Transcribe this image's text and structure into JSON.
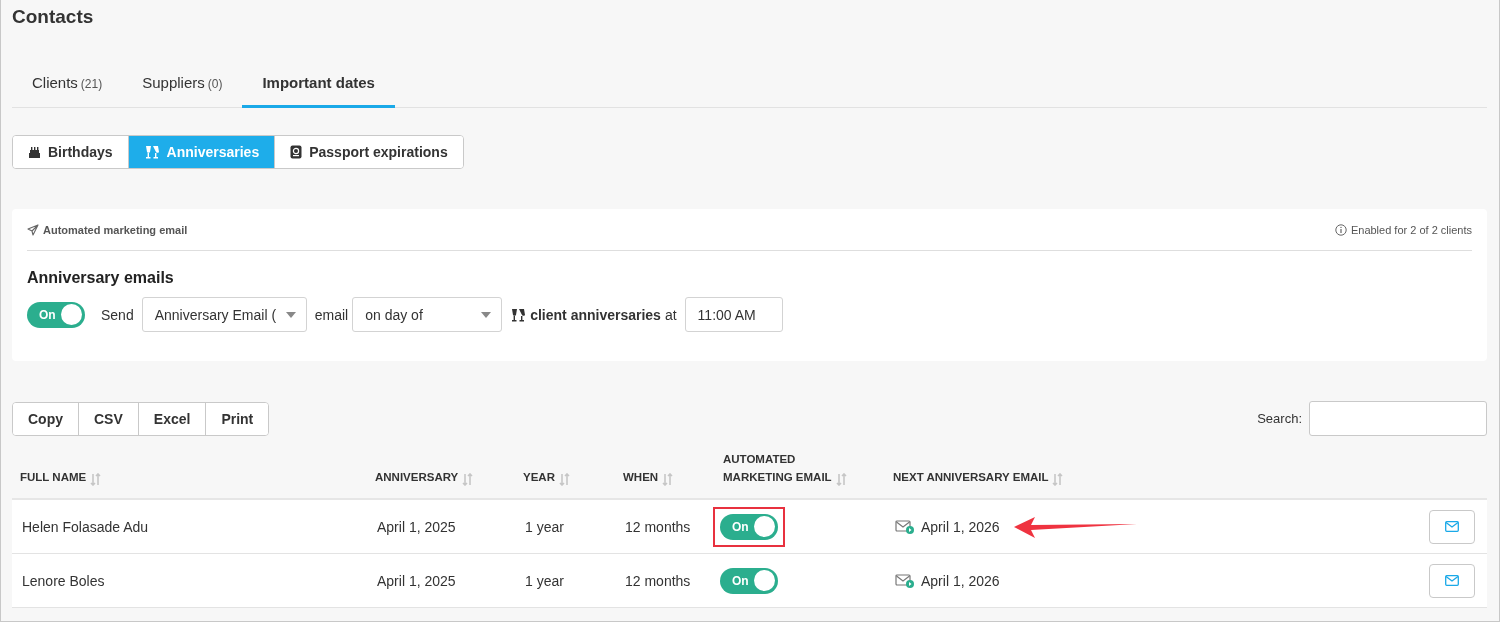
{
  "page": {
    "title": "Contacts"
  },
  "tabs": [
    {
      "label": "Clients",
      "count": "(21)",
      "selected": false
    },
    {
      "label": "Suppliers",
      "count": "(0)",
      "selected": false
    },
    {
      "label": "Important dates",
      "selected": true
    }
  ],
  "date_types": [
    {
      "label": "Birthdays",
      "kind": "cake",
      "selected": false
    },
    {
      "label": "Anniversaries",
      "kind": "cheers",
      "selected": true
    },
    {
      "label": "Passport expirations",
      "kind": "passport",
      "selected": false
    }
  ],
  "automation": {
    "caption": "Automated marketing email",
    "status": "Enabled for 2 of 2 clients",
    "heading": "Anniversary emails",
    "toggle": {
      "label": "On",
      "on": true
    },
    "send_label": "Send",
    "template": {
      "value": "Anniversary Email ("
    },
    "email_label": "email",
    "timing": {
      "value": "on day of"
    },
    "target_label": "client anniversaries",
    "at_label": "at",
    "time": {
      "value": "11:00 AM"
    }
  },
  "export_buttons": [
    "Copy",
    "CSV",
    "Excel",
    "Print"
  ],
  "search": {
    "label": "Search:"
  },
  "table": {
    "columns": [
      [
        "FULL NAME"
      ],
      [
        "ANNIVERSARY"
      ],
      [
        "YEAR"
      ],
      [
        "WHEN"
      ],
      [
        "AUTOMATED",
        "MARKETING EMAIL"
      ],
      [
        "NEXT ANNIVERSARY EMAIL"
      ]
    ],
    "rows": [
      {
        "full_name": "Helen Folasade Adu",
        "anniversary": "April 1, 2025",
        "year": "1 year",
        "when": "12 months",
        "automated": {
          "label": "On",
          "on": true
        },
        "next_email": "April 1, 2026",
        "highlighted": true
      },
      {
        "full_name": "Lenore Boles",
        "anniversary": "April 1, 2025",
        "year": "1 year",
        "when": "12 months",
        "automated": {
          "label": "On",
          "on": true
        },
        "next_email": "April 1, 2026",
        "highlighted": false
      }
    ]
  }
}
